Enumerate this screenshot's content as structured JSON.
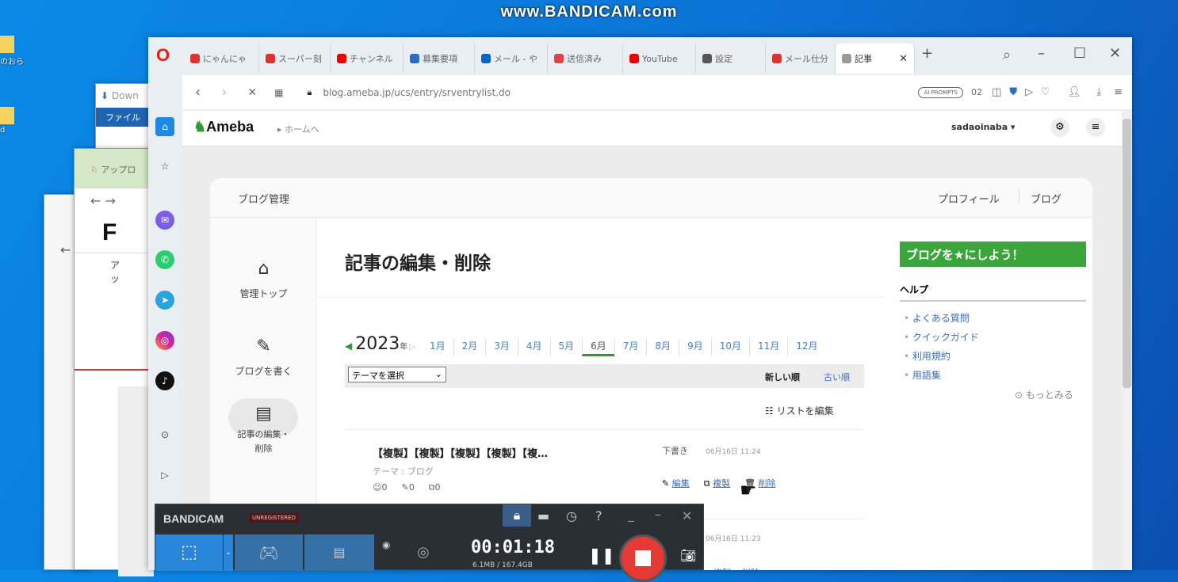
{
  "watermark": "www.BANDICAM.com",
  "desktop": {
    "icon1_label": "のおら",
    "icon2_label": "d"
  },
  "bg_windows": {
    "download_title": "Down",
    "download_menu": "ファイル",
    "upload_tab": "アップロ",
    "upload_button": "アッ",
    "upload_logo": "F"
  },
  "tabs": [
    {
      "label": "にゃんにゃ",
      "color": "#d33"
    },
    {
      "label": "スーパー刻",
      "color": "#d33"
    },
    {
      "label": "チャンネル",
      "color": "#e00"
    },
    {
      "label": "募集要項",
      "color": "#2b6cc4"
    },
    {
      "label": "メール - や",
      "color": "#0a64c8"
    },
    {
      "label": "送信済み",
      "color": "#d44"
    },
    {
      "label": "YouTube",
      "color": "#e00"
    },
    {
      "label": "設定",
      "color": "#555"
    },
    {
      "label": "メール仕分",
      "color": "#d33"
    },
    {
      "label": "記事",
      "color": "#999",
      "active": true
    }
  ],
  "address": {
    "url": "blog.ameba.jp/ucs/entry/srventrylist.do",
    "prompts": "AI PROMPTS",
    "badge": "02"
  },
  "ameba": {
    "logo": "Ameba",
    "home_link": "ホームへ",
    "user": "sadaoinaba ▾"
  },
  "card": {
    "title": "ブログ管理",
    "profile": "プロフィール",
    "blog": "ブログ"
  },
  "nav": [
    {
      "label": "管理トップ",
      "icon": "⌂"
    },
    {
      "label": "ブログを書く",
      "icon": "✎"
    },
    {
      "label": "記事の編集・\n削除",
      "icon": "▤"
    }
  ],
  "main": {
    "heading": "記事の編集・削除",
    "year": "2023",
    "year_suffix": "年",
    "months": [
      "1月",
      "2月",
      "3月",
      "4月",
      "5月",
      "6月",
      "7月",
      "8月",
      "9月",
      "10月",
      "11月",
      "12月"
    ],
    "active_month": "6月",
    "theme_select": "テーマを選択",
    "sort_new": "新しい順",
    "sort_old": "古い順",
    "edit_list": "リストを編集",
    "entries": [
      {
        "title": "【複製】【複製】【複製】【複製】【複…",
        "status": "下書き",
        "date": "06月16日 11:24",
        "theme": "テーマ : ブログ",
        "likes": "0",
        "comments": "0",
        "reblogs": "0",
        "edit": "編集",
        "copy": "複製",
        "delete": "削除"
      },
      {
        "date": "06月16日 11:23",
        "copy": "複製",
        "delete": "削除"
      }
    ]
  },
  "right": {
    "banner": "ブログを★にしよう！",
    "help_title": "ヘルプ",
    "help_links": [
      "よくある質問",
      "クイックガイド",
      "利用規約",
      "用語集"
    ],
    "more": "もっとみる"
  },
  "bandicam": {
    "logo": "BANDICAM",
    "unreg": "UNREGISTERED",
    "time": "00:01:18",
    "size": "6.1MB / 167.4GB"
  },
  "colors": {
    "ameba_green": "#2d9b2d",
    "bandicam_blue": "#2a86d8",
    "record_red": "#e53935"
  }
}
